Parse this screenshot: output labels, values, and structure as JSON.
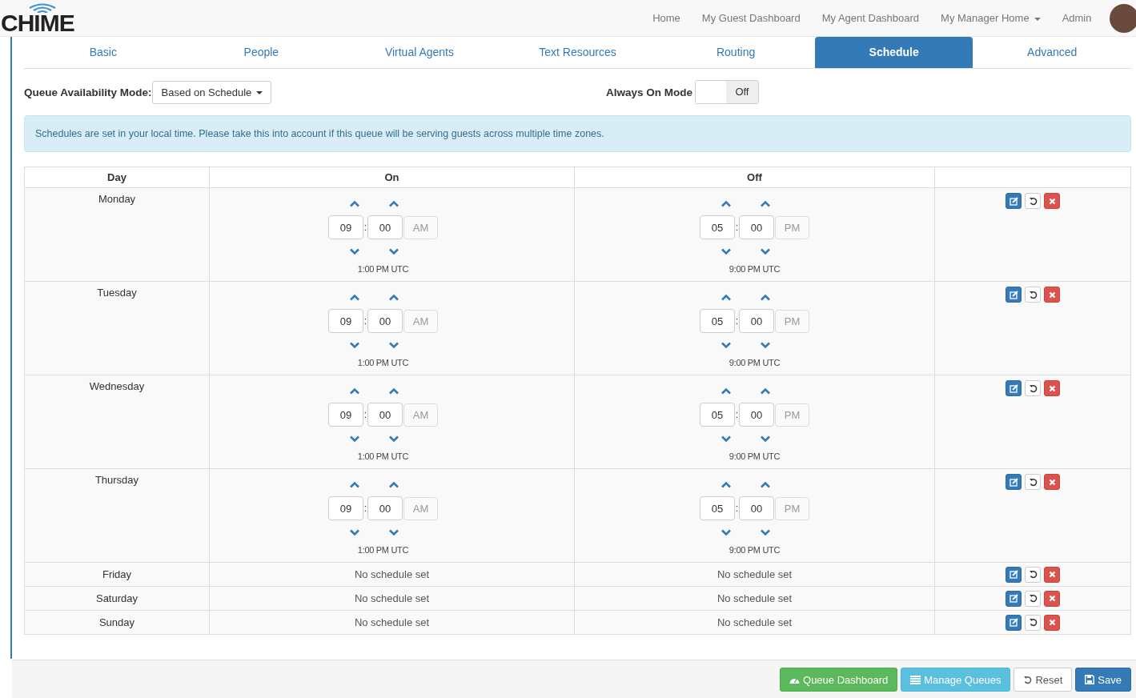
{
  "brand": {
    "name": "CHIME"
  },
  "nav": [
    {
      "label": "Home",
      "dropdown": false
    },
    {
      "label": "My Guest Dashboard",
      "dropdown": false
    },
    {
      "label": "My Agent Dashboard",
      "dropdown": false
    },
    {
      "label": "My Manager Home",
      "dropdown": true
    },
    {
      "label": "Admin",
      "dropdown": false
    }
  ],
  "tabs": [
    {
      "label": "Basic",
      "selected": false
    },
    {
      "label": "People",
      "selected": false
    },
    {
      "label": "Virtual Agents",
      "selected": false
    },
    {
      "label": "Text Resources",
      "selected": false
    },
    {
      "label": "Routing",
      "selected": false
    },
    {
      "label": "Schedule",
      "selected": true
    },
    {
      "label": "Advanced",
      "selected": false
    }
  ],
  "availability": {
    "label": "Queue Availability Mode:",
    "value": "Based on Schedule"
  },
  "always_on": {
    "label": "Always On Mode",
    "on": false,
    "state_text": "Off"
  },
  "alert": "Schedules are set in your local time. Please take this into account if this queue will be serving guests across multiple time zones.",
  "table": {
    "columns": [
      "Day",
      "On",
      "Off",
      ""
    ],
    "time_separator": ":",
    "rows": [
      {
        "day": "Monday",
        "kind": "schedule",
        "on": {
          "hour": "09",
          "minute": "00",
          "meridiem": "AM",
          "utc": "1:00 PM UTC"
        },
        "off": {
          "hour": "05",
          "minute": "00",
          "meridiem": "PM",
          "utc": "9:00 PM UTC"
        }
      },
      {
        "day": "Tuesday",
        "kind": "schedule",
        "on": {
          "hour": "09",
          "minute": "00",
          "meridiem": "AM",
          "utc": "1:00 PM UTC"
        },
        "off": {
          "hour": "05",
          "minute": "00",
          "meridiem": "PM",
          "utc": "9:00 PM UTC"
        }
      },
      {
        "day": "Wednesday",
        "kind": "schedule",
        "on": {
          "hour": "09",
          "minute": "00",
          "meridiem": "AM",
          "utc": "1:00 PM UTC"
        },
        "off": {
          "hour": "05",
          "minute": "00",
          "meridiem": "PM",
          "utc": "9:00 PM UTC"
        }
      },
      {
        "day": "Thursday",
        "kind": "schedule",
        "on": {
          "hour": "09",
          "minute": "00",
          "meridiem": "AM",
          "utc": "1:00 PM UTC"
        },
        "off": {
          "hour": "05",
          "minute": "00",
          "meridiem": "PM",
          "utc": "9:00 PM UTC"
        }
      },
      {
        "day": "Friday",
        "kind": "empty",
        "on_text": "No schedule set",
        "off_text": "No schedule set"
      },
      {
        "day": "Saturday",
        "kind": "empty",
        "on_text": "No schedule set",
        "off_text": "No schedule set"
      },
      {
        "day": "Sunday",
        "kind": "empty",
        "on_text": "No schedule set",
        "off_text": "No schedule set"
      }
    ]
  },
  "footer_buttons": [
    {
      "label": "Queue Dashboard",
      "kind": "dashboard"
    },
    {
      "label": "Manage Queues",
      "kind": "list"
    },
    {
      "label": "Reset",
      "kind": "reset"
    },
    {
      "label": "Save",
      "kind": "save"
    }
  ]
}
